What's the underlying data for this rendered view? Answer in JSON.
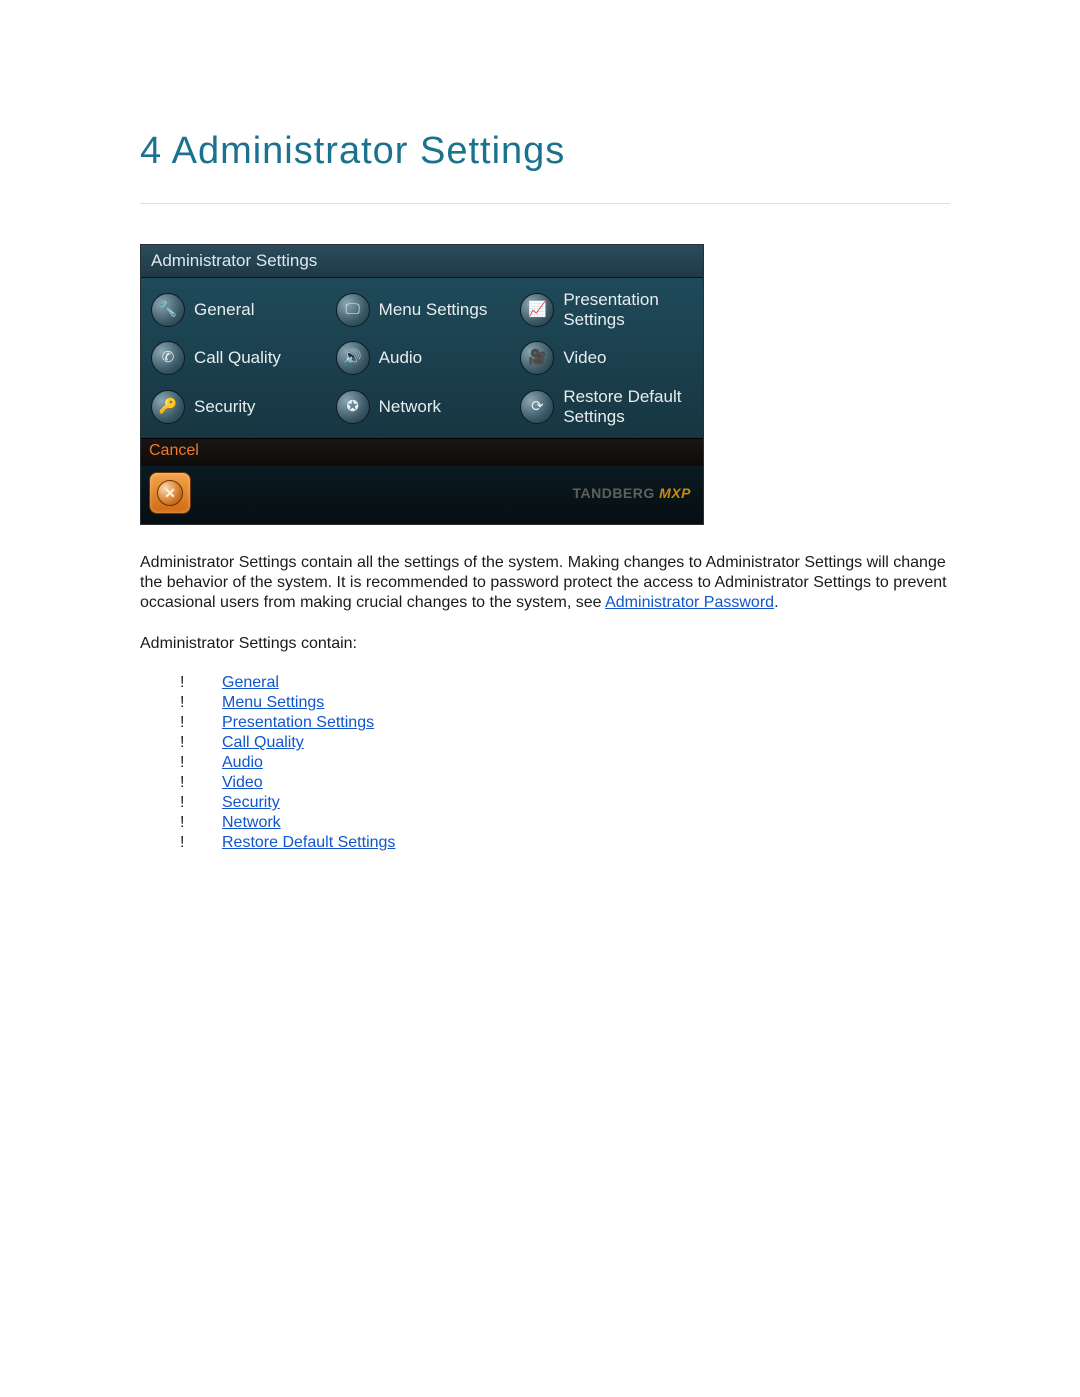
{
  "title": "4 Administrator Settings",
  "panel": {
    "header": "Administrator Settings",
    "items": [
      {
        "label": "General",
        "icon": "wrench-icon",
        "glyph": "🔧"
      },
      {
        "label": "Menu Settings",
        "icon": "monitor-icon",
        "glyph": "🖵"
      },
      {
        "label": "Presentation Settings",
        "icon": "chart-icon",
        "glyph": "📈"
      },
      {
        "label": "Call Quality",
        "icon": "handset-icon",
        "glyph": "✆"
      },
      {
        "label": "Audio",
        "icon": "speaker-icon",
        "glyph": "🔊"
      },
      {
        "label": "Video",
        "icon": "camera-icon",
        "glyph": "🎥"
      },
      {
        "label": "Security",
        "icon": "key-icon",
        "glyph": "🔑"
      },
      {
        "label": "Network",
        "icon": "globe-icon",
        "glyph": "✪"
      },
      {
        "label": "Restore Default Settings",
        "icon": "refresh-icon",
        "glyph": "⟳"
      }
    ],
    "cancel": "Cancel",
    "brand": "TANDBERG",
    "brand_suffix": "MXP"
  },
  "paragraph": {
    "part1": "Administrator Settings contain all the settings of the system. Making changes to Administrator Settings will change the behavior of the system. It is recommended to password protect the access to Administrator Settings to prevent occasional users from making crucial changes to the system, see ",
    "link_text": "Administrator Password",
    "part2": "."
  },
  "subhead": "Administrator Settings contain:",
  "links": [
    "General",
    "Menu Settings",
    "Presentation Settings",
    "Call Quality",
    "Audio",
    "Video",
    "Security",
    "Network",
    "Restore Default Settings"
  ]
}
